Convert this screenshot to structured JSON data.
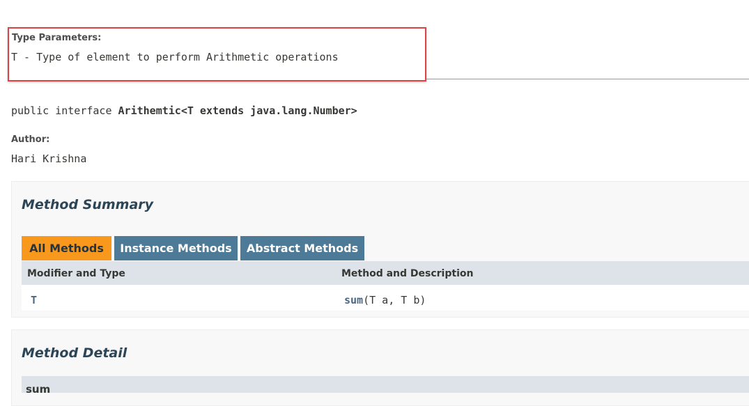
{
  "type_params": {
    "label": "Type Parameters:",
    "value": "T - Type of element to perform Arithmetic operations"
  },
  "signature": {
    "prefix": "public interface ",
    "name": "Arithemtic<T extends java.lang.Number>"
  },
  "author": {
    "label": "Author:",
    "value": "Hari Krishna"
  },
  "method_summary": {
    "title": "Method Summary",
    "tabs": [
      "All Methods",
      "Instance Methods",
      "Abstract Methods"
    ],
    "columns": [
      "Modifier and Type",
      "Method and Description"
    ],
    "rows": [
      {
        "type": "T",
        "method_name": "sum",
        "method_params": "(T a, T b)"
      }
    ]
  },
  "method_detail": {
    "title": "Method Detail",
    "method_name": "sum"
  },
  "colors": {
    "highlight": "#e04141",
    "tab_active": "#f8981d",
    "tab_inactive": "#4d7a97",
    "link": "#4a6782",
    "table_header": "#dee3e9"
  }
}
